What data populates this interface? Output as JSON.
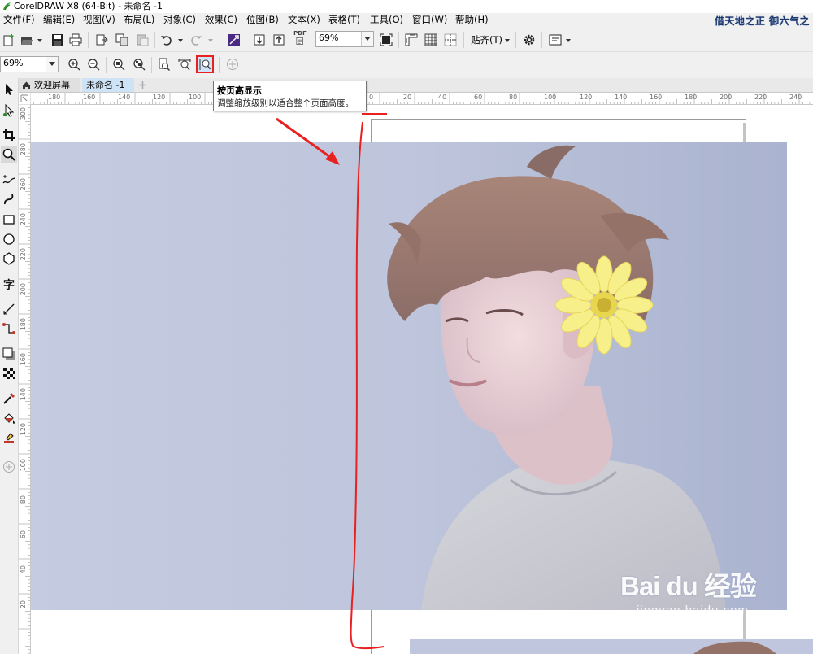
{
  "window": {
    "title": "CorelDRAW X8 (64-Bit) - 未命名 -1"
  },
  "menu": {
    "items": [
      "文件(F)",
      "编辑(E)",
      "视图(V)",
      "布局(L)",
      "对象(C)",
      "效果(C)",
      "位图(B)",
      "文本(X)",
      "表格(T)",
      "工具(O)",
      "窗口(W)",
      "帮助(H)"
    ],
    "slogan": "借天地之正 御六气之"
  },
  "toolbar1": {
    "zoom_value": "69%",
    "pdf_label": "PDF",
    "snap_label": "贴齐(T)"
  },
  "toolbar2": {
    "zoom_value": "69%"
  },
  "tooltip": {
    "title": "按页高显示",
    "description": "调整缩放级别以适合整个页面高度。"
  },
  "tabs": {
    "welcome": "欢迎屏幕",
    "document": "未命名 -1"
  },
  "ruler": {
    "h_labels": [
      "180",
      "160",
      "140",
      "120",
      "100",
      "0",
      "20",
      "40",
      "60",
      "80",
      "100",
      "120",
      "140",
      "160",
      "180",
      "200",
      "220",
      "240"
    ],
    "v_labels": [
      "300",
      "280",
      "260",
      "240",
      "220",
      "200",
      "180",
      "160",
      "140",
      "120",
      "100",
      "80",
      "60",
      "40",
      "20"
    ]
  },
  "watermark": {
    "logo": "Bai du 经验",
    "url": "jingyan.baidu.com"
  },
  "colors": {
    "accent_highlight": "#e82020",
    "selected_tool_bg": "#cfe5f7",
    "photo_bg": "#b9c1d8"
  }
}
